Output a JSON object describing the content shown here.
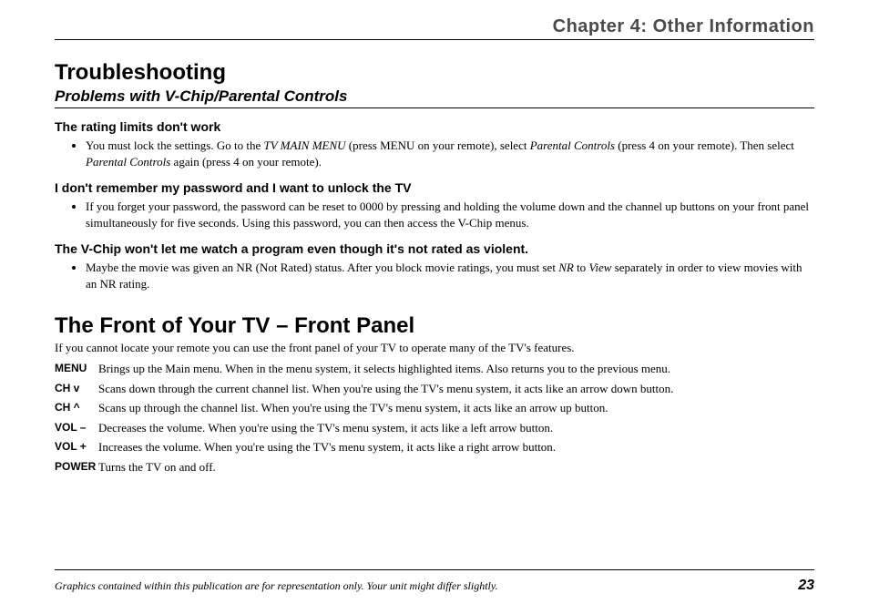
{
  "header": {
    "chapter": "Chapter 4: Other Information"
  },
  "troubleshooting": {
    "title": "Troubleshooting",
    "subtitle": "Problems with V-Chip/Parental Controls",
    "problems": {
      "p1": {
        "heading": "The rating limits don't work",
        "bullet_pre": "You must lock the settings. Go to the ",
        "bullet_em1": "TV MAIN MENU",
        "bullet_mid1": " (press MENU on your remote), select ",
        "bullet_em2": "Parental Controls",
        "bullet_mid2": " (press 4 on your remote). Then select ",
        "bullet_em3": "Parental Controls",
        "bullet_post": " again (press 4 on your remote)."
      },
      "p2": {
        "heading": "I don't remember my password and I want to unlock the TV",
        "bullet": "If you forget your password, the password can be reset to 0000 by pressing and holding the volume down and the channel up buttons on your front panel simultaneously for five seconds. Using this password, you can then access the V-Chip menus."
      },
      "p3": {
        "heading": "The V-Chip won't let me watch a program even though it's not rated as violent.",
        "bullet_pre": "Maybe the movie was given an NR (Not Rated) status. After you block movie ratings, you must set ",
        "bullet_em1": "NR",
        "bullet_mid": " to ",
        "bullet_em2": "View",
        "bullet_post": " separately in order to view movies with an NR rating."
      }
    }
  },
  "frontpanel": {
    "title": "The Front of Your TV – Front Panel",
    "lead": "If you cannot locate your remote you can use the front panel of your TV to operate many of the TV's features.",
    "rows": {
      "menu": {
        "term": "MENU",
        "desc": "Brings up the Main menu. When in the menu system, it selects highlighted items. Also returns you to the previous menu."
      },
      "chdown": {
        "term": "CH v",
        "desc": "Scans down through the current channel list. When you're using the TV's menu system, it acts like an arrow down button."
      },
      "chup": {
        "term": "CH ^",
        "desc": "Scans up through the channel list. When you're using the TV's menu system, it acts like an arrow up button."
      },
      "voldn": {
        "term": "VOL –",
        "desc": "Decreases the volume. When you're using the TV's menu system, it acts like a left arrow button."
      },
      "volup": {
        "term": "VOL +",
        "desc": "Increases the volume. When you're using the TV's menu system, it acts like a right arrow button."
      },
      "power": {
        "term": "POWER",
        "desc": "Turns the TV on and off."
      }
    }
  },
  "footer": {
    "disclaimer": "Graphics contained within this publication are for representation only. Your unit might differ slightly.",
    "page": "23"
  }
}
